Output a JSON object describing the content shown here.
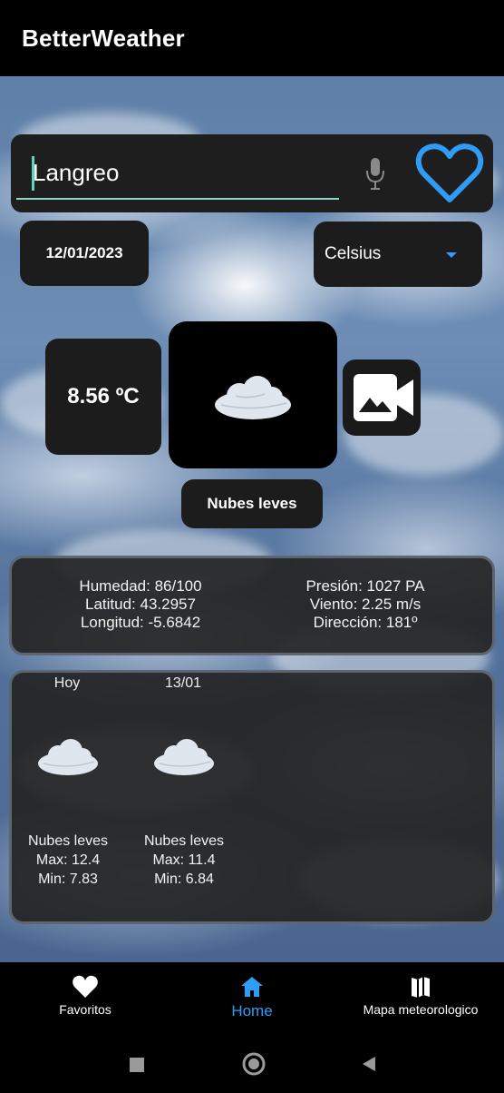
{
  "app": {
    "title": "BetterWeather"
  },
  "search": {
    "value": "Langreo",
    "placeholder": ""
  },
  "date": "12/01/2023",
  "unit": {
    "selected": "Celsius"
  },
  "current": {
    "temperature": "8.56 ºC",
    "description": "Nubes leves"
  },
  "details": {
    "left": [
      "Humedad: 86/100",
      "Latitud: 43.2957",
      "Longitud: -5.6842"
    ],
    "right": [
      "Presión: 1027 PA",
      "Viento: 2.25 m/s",
      "Dirección: 181º"
    ]
  },
  "forecast": [
    {
      "day": "Hoy",
      "description": "Nubes leves",
      "max": "Max: 12.4",
      "min": "Min: 7.83"
    },
    {
      "day": "13/01",
      "description": "Nubes leves",
      "max": "Max: 11.4",
      "min": "Min: 6.84"
    }
  ],
  "nav": {
    "favorites": "Favoritos",
    "home": "Home",
    "map": "Mapa meteorologico"
  },
  "colors": {
    "accent": "#2f9cf5",
    "input_underline": "#8fd6c6"
  },
  "icons": [
    "mic-icon",
    "heart-icon",
    "cloud-icon",
    "camera-icon",
    "home-icon",
    "map-icon"
  ]
}
